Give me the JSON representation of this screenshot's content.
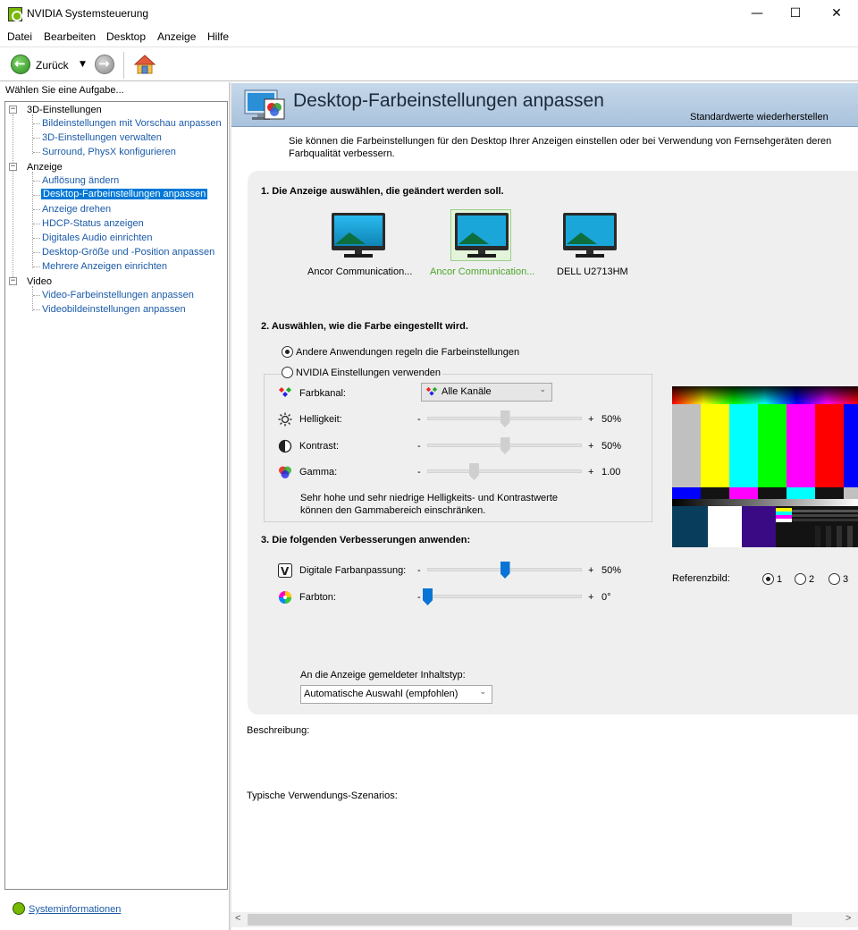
{
  "window": {
    "title": "NVIDIA Systemsteuerung",
    "minimize": "—",
    "maximize": "☐",
    "close": "✕"
  },
  "menu": [
    "Datei",
    "Bearbeiten",
    "Desktop",
    "Anzeige",
    "Hilfe"
  ],
  "toolbar": {
    "back_label": "Zurück",
    "dropdown_arrow": "▼"
  },
  "left": {
    "header": "Wählen Sie eine Aufgabe...",
    "categories": [
      {
        "label": "3D-Einstellungen",
        "items": [
          "Bildeinstellungen mit Vorschau anpassen",
          "3D-Einstellungen verwalten",
          "Surround, PhysX konfigurieren"
        ]
      },
      {
        "label": "Anzeige",
        "items": [
          "Auflösung ändern",
          "Desktop-Farbeinstellungen anpassen",
          "Anzeige drehen",
          "HDCP-Status anzeigen",
          "Digitales Audio einrichten",
          "Desktop-Größe und -Position anpassen",
          "Mehrere Anzeigen einrichten"
        ]
      },
      {
        "label": "Video",
        "items": [
          "Video-Farbeinstellungen anpassen",
          "Videobildeinstellungen anpassen"
        ]
      }
    ],
    "selected": "Desktop-Farbeinstellungen anpassen",
    "system_info": "Systeminformationen"
  },
  "page": {
    "title": "Desktop-Farbeinstellungen anpassen",
    "restore_defaults": "Standardwerte wiederherstellen",
    "intro": "Sie können die Farbeinstellungen für den Desktop Ihrer Anzeigen einstellen oder bei Verwendung von Fernsehgeräten deren Farbqualität verbessern."
  },
  "section1": {
    "title": "1. Die Anzeige auswählen, die geändert werden soll.",
    "displays": [
      {
        "label": "Ancor Communication...",
        "selected": false
      },
      {
        "label": "Ancor Communication...",
        "selected": true
      },
      {
        "label": "DELL U2713HM",
        "selected": false
      }
    ]
  },
  "section2": {
    "title": "2. Auswählen, wie die Farbe eingestellt wird.",
    "option_other": "Andere Anwendungen regeln die Farbeinstellungen",
    "option_nvidia": "NVIDIA Einstellungen verwenden",
    "selected_option": "other",
    "channel_label": "Farbkanal:",
    "channel_value": "Alle Kanäle",
    "brightness": {
      "label": "Helligkeit:",
      "minus": "-",
      "plus": "+",
      "value": "50%",
      "level": 0.5
    },
    "contrast": {
      "label": "Kontrast:",
      "minus": "-",
      "plus": "+",
      "value": "50%",
      "level": 0.5
    },
    "gamma": {
      "label": "Gamma:",
      "minus": "-",
      "plus": "+",
      "value": "1.00",
      "level": 0.3
    },
    "note": "Sehr hohe und sehr niedrige Helligkeits- und Kontrastwerte können den Gammabereich einschränken."
  },
  "section3": {
    "title": "3. Die folgenden Verbesserungen anwenden:",
    "vibrance": {
      "label": "Digitale Farbanpassung:",
      "minus": "-",
      "plus": "+",
      "value": "50%",
      "level": 0.5
    },
    "hue": {
      "label": "Farbton:",
      "minus": "-",
      "plus": "+",
      "value": "0°",
      "level": 0.0
    },
    "content_type_label": "An die Anzeige gemeldeter Inhaltstyp:",
    "content_type_value": "Automatische Auswahl (empfohlen)"
  },
  "reference": {
    "label": "Referenzbild:",
    "options": [
      "1",
      "2",
      "3"
    ],
    "selected": "1"
  },
  "description_label": "Beschreibung:",
  "scenarios_label": "Typische Verwendungs-Szenarios:",
  "scroll": {
    "left": "<",
    "right": ">"
  },
  "colors": {
    "accent": "#0078d7",
    "nvidia_green": "#76b900",
    "link": "#1a5aa8",
    "header_band": "#b8cde3",
    "selected_display_text": "#4aa628"
  }
}
